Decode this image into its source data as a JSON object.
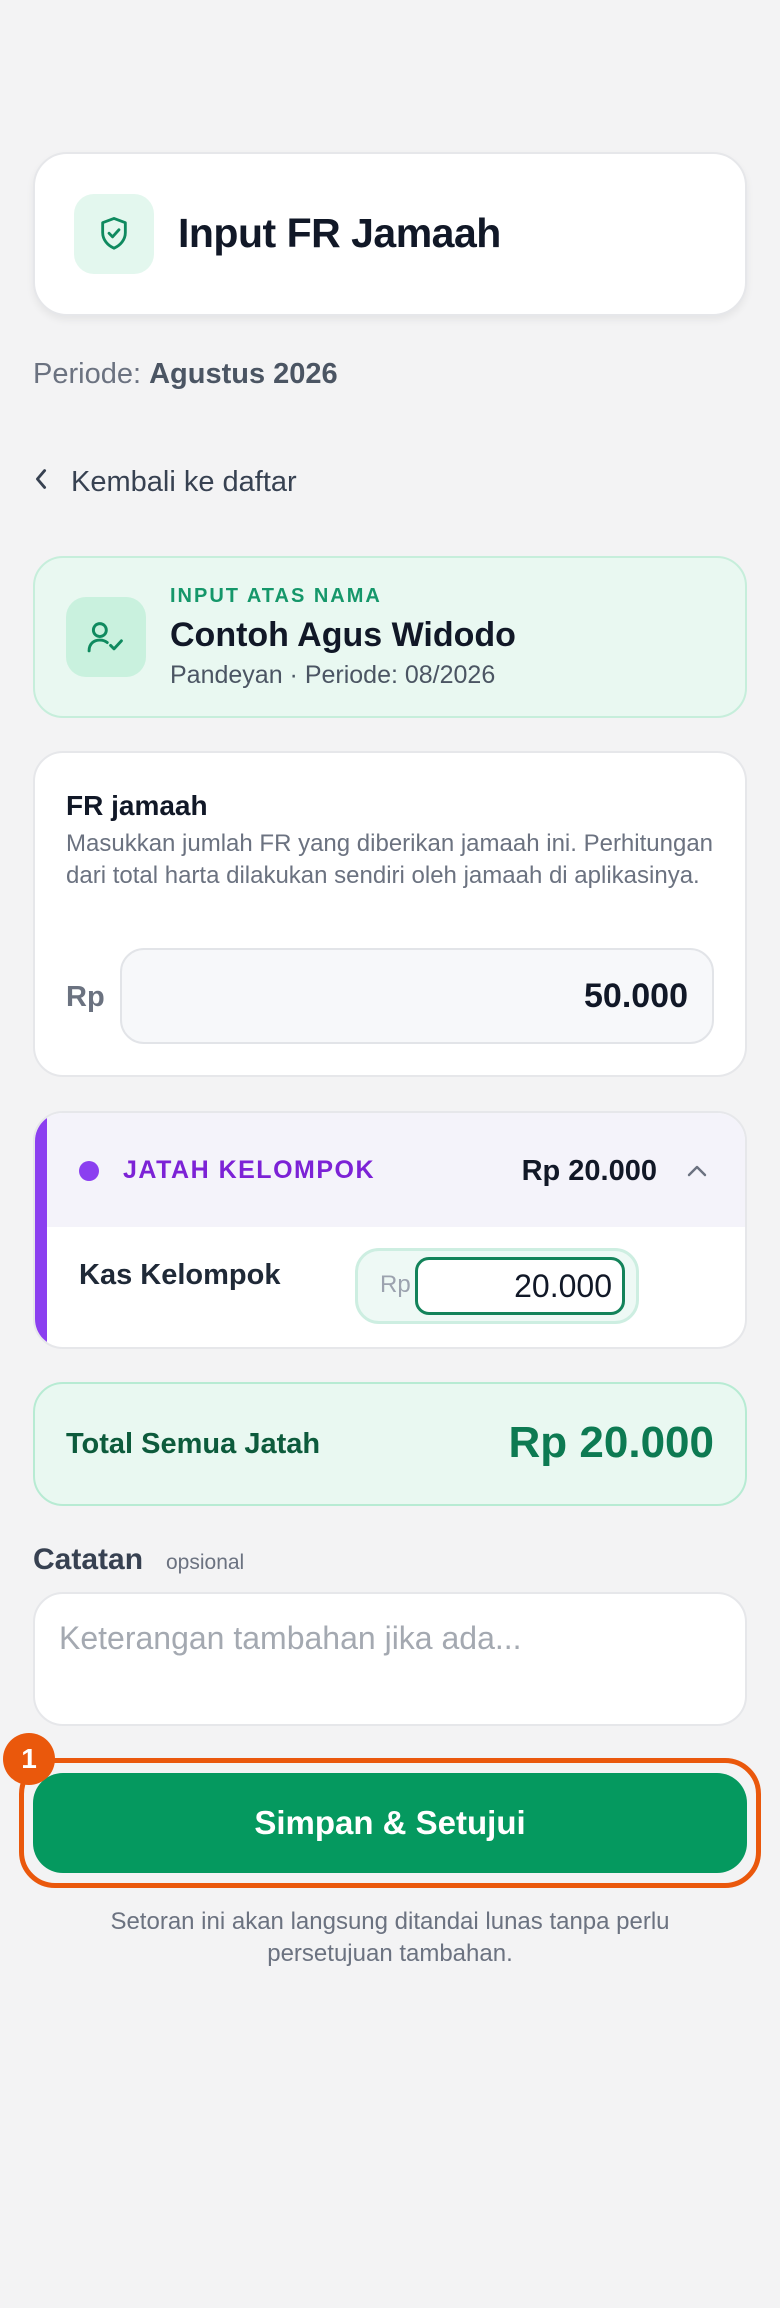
{
  "header": {
    "title": "Input FR Jamaah",
    "icon": "shield-check-icon"
  },
  "periode": {
    "label": "Periode:",
    "value": "Agustus 2026"
  },
  "back_link": {
    "label": "Kembali ke daftar",
    "icon": "chevron-left-icon"
  },
  "atas_nama": {
    "kicker": "INPUT ATAS NAMA",
    "name": "Contoh Agus Widodo",
    "subtitle": "Pandeyan · Periode: 08/2026",
    "icon": "user-check-icon"
  },
  "fr_jamaah": {
    "title": "FR jamaah",
    "description": "Masukkan jumlah FR yang diberikan jamaah ini. Perhitungan dari total harta dilakukan sendiri oleh jamaah di aplikasinya.",
    "currency": "Rp",
    "value": "50.000"
  },
  "jatah_kelompok": {
    "label": "JATAH KELOMPOK",
    "total": "Rp 20.000",
    "accent_color": "#8b3ff0",
    "expanded": true,
    "items": [
      {
        "label": "Kas Kelompok",
        "currency": "Rp",
        "value": "20.000"
      }
    ]
  },
  "total": {
    "label": "Total Semua Jatah",
    "value": "Rp 20.000"
  },
  "catatan": {
    "label": "Catatan",
    "optional": "opsional",
    "placeholder": "Keterangan tambahan jika ada..."
  },
  "actions": {
    "save_label": "Simpan & Setujui",
    "badge": "1",
    "note": "Setoran ini akan langsung ditandai lunas tanpa perlu persetujuan tambahan."
  },
  "colors": {
    "primary": "#05995f",
    "highlight": "#ea580c",
    "background": "#f3f3f4"
  }
}
